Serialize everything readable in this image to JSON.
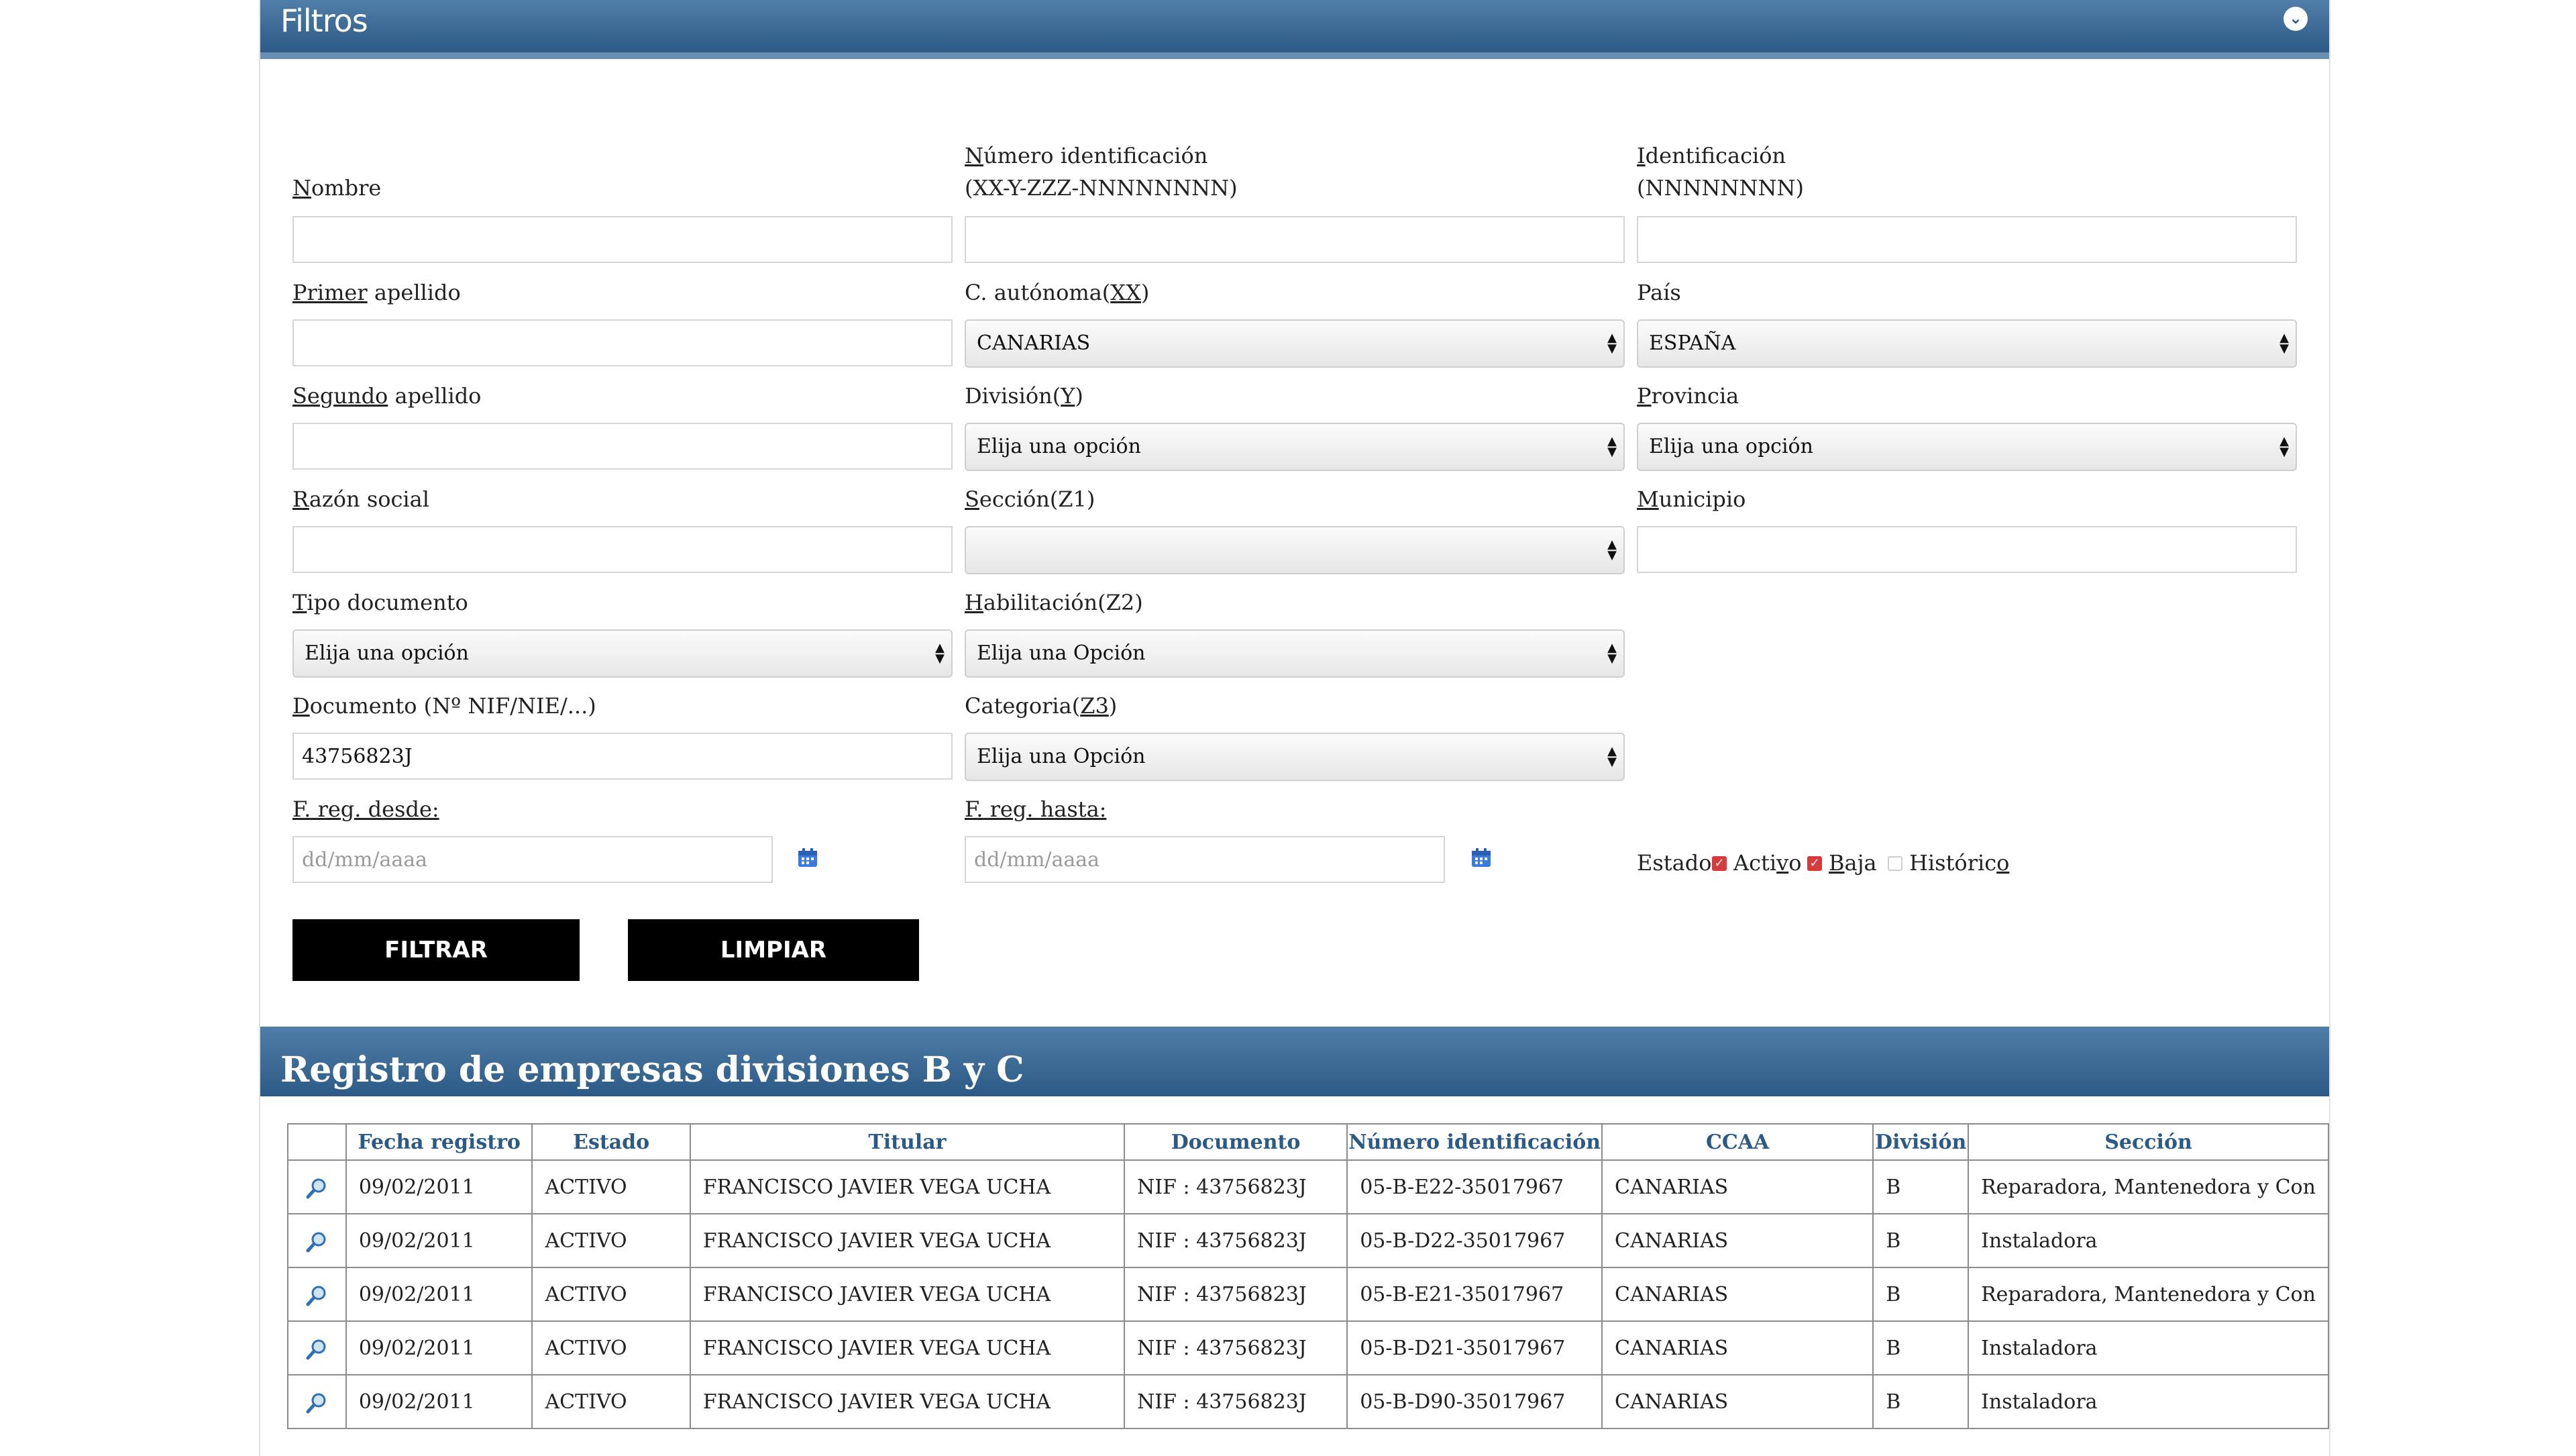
{
  "filters": {
    "title": "Filtros",
    "collapse_glyph": "⌄",
    "fields": {
      "nombre": {
        "label_u": "N",
        "label_rest": "ombre",
        "value": ""
      },
      "numero_id": {
        "label_u": "N",
        "label_rest": "úmero identificación",
        "label_line2": "(XX-Y-ZZZ-NNNNNNNN)",
        "value": ""
      },
      "identificacion": {
        "label_u": "I",
        "label_rest": "dentificación",
        "label_line2": "(NNNNNNNN)",
        "value": ""
      },
      "primer_apellido": {
        "label_u": "Primer",
        "label_rest": " apellido",
        "value": ""
      },
      "c_autonoma": {
        "label_pre": "C. autónoma(",
        "label_u": "XX",
        "label_post": ")",
        "value": "CANARIAS"
      },
      "pais": {
        "label": "País",
        "value": "ESPAÑA"
      },
      "segundo_apellido": {
        "label_u": "Segundo",
        "label_rest": " apellido",
        "value": ""
      },
      "division": {
        "label_pre": "División(",
        "label_u": "Y",
        "label_post": ")",
        "value": "Elija una opción"
      },
      "provincia": {
        "label_u": "P",
        "label_rest": "rovincia",
        "value": "Elija una opción"
      },
      "razon_social": {
        "label_u": "R",
        "label_rest": "azón social",
        "value": ""
      },
      "seccion": {
        "label_u": "S",
        "label_rest": "ección(Z1)",
        "value": ""
      },
      "municipio": {
        "label_u": "M",
        "label_rest": "unicipio",
        "value": ""
      },
      "tipo_documento": {
        "label_u": "T",
        "label_rest": "ipo documento",
        "value": "Elija una opción"
      },
      "habilitacion": {
        "label_u": "H",
        "label_rest": "abilitación(Z2)",
        "value": "Elija una Opción"
      },
      "documento": {
        "label_u": "D",
        "label_rest": "ocumento (Nº NIF/NIE/...)",
        "value": "43756823J"
      },
      "categoria": {
        "label_pre": "Categoria(",
        "label_u": "Z3",
        "label_post": ")",
        "value": "Elija una Opción"
      },
      "f_reg_desde": {
        "label": "F. reg. desde:",
        "placeholder": "dd/mm/aaaa",
        "value": ""
      },
      "f_reg_hasta": {
        "label": "F. reg. hasta:",
        "placeholder": "dd/mm/aaaa",
        "value": ""
      }
    },
    "estado": {
      "label": "Estado",
      "options": [
        {
          "label_pre": "Acti",
          "label_u": "v",
          "label_post": "o",
          "checked": true
        },
        {
          "label_pre": "",
          "label_u": "B",
          "label_post": "aja",
          "checked": true
        },
        {
          "label_pre": "Históric",
          "label_u": "o",
          "label_post": "",
          "checked": false
        }
      ]
    },
    "buttons": {
      "filtrar": "FILTRAR",
      "limpiar": "LIMPIAR"
    },
    "icons": {
      "calendar": "calendar-icon",
      "view": "magnifier-icon"
    },
    "colors": {
      "header": "#2c5a86",
      "accent": "#4f7ea8",
      "checked": "#d63a3a",
      "calendar": "#3b7be0"
    }
  },
  "results": {
    "title": "Registro de empresas divisiones B y C",
    "columns": [
      "",
      "Fecha registro",
      "Estado",
      "Titular",
      "Documento",
      "Número identificación",
      "CCAA",
      "División",
      "Sección"
    ],
    "rows": [
      {
        "fecha": "09/02/2011",
        "estado": "ACTIVO",
        "titular": "FRANCISCO JAVIER VEGA UCHA",
        "documento": "NIF : 43756823J",
        "numero": "05-B-E22-35017967",
        "ccaa": "CANARIAS",
        "division": "B",
        "seccion": "Reparadora, Mantenedora y Con"
      },
      {
        "fecha": "09/02/2011",
        "estado": "ACTIVO",
        "titular": "FRANCISCO JAVIER VEGA UCHA",
        "documento": "NIF : 43756823J",
        "numero": "05-B-D22-35017967",
        "ccaa": "CANARIAS",
        "division": "B",
        "seccion": "Instaladora"
      },
      {
        "fecha": "09/02/2011",
        "estado": "ACTIVO",
        "titular": "FRANCISCO JAVIER VEGA UCHA",
        "documento": "NIF : 43756823J",
        "numero": "05-B-E21-35017967",
        "ccaa": "CANARIAS",
        "division": "B",
        "seccion": "Reparadora, Mantenedora y Con"
      },
      {
        "fecha": "09/02/2011",
        "estado": "ACTIVO",
        "titular": "FRANCISCO JAVIER VEGA UCHA",
        "documento": "NIF : 43756823J",
        "numero": "05-B-D21-35017967",
        "ccaa": "CANARIAS",
        "division": "B",
        "seccion": "Instaladora"
      },
      {
        "fecha": "09/02/2011",
        "estado": "ACTIVO",
        "titular": "FRANCISCO JAVIER VEGA UCHA",
        "documento": "NIF : 43756823J",
        "numero": "05-B-D90-35017967",
        "ccaa": "CANARIAS",
        "division": "B",
        "seccion": "Instaladora"
      }
    ]
  }
}
